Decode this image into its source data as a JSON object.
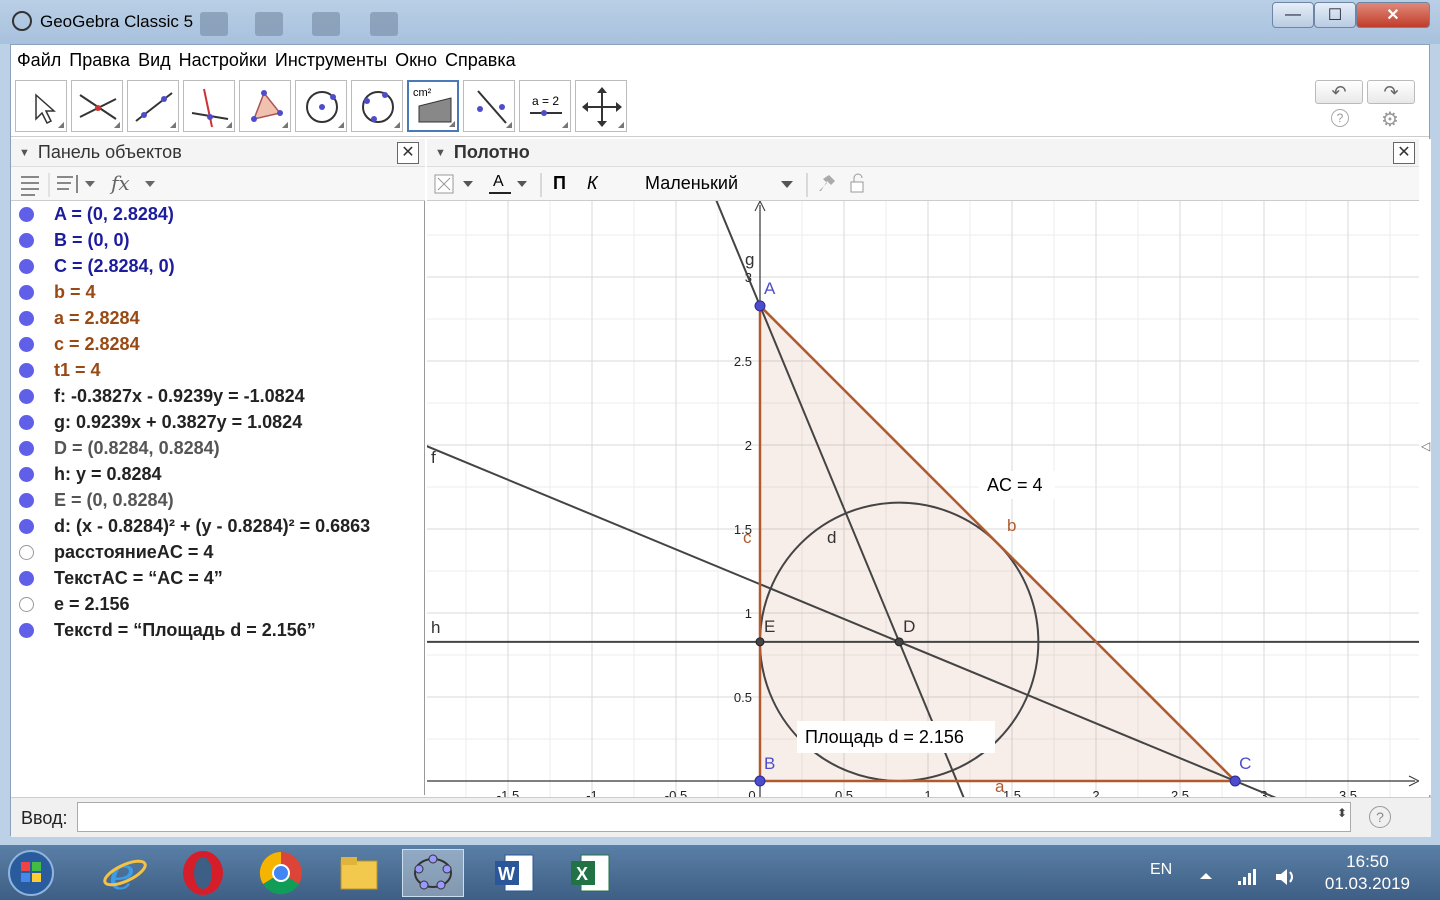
{
  "window": {
    "title": "GeoGebra Classic 5",
    "min_symbol": "—",
    "max_symbol": "☐",
    "close_symbol": "✕"
  },
  "menu": [
    "Файл",
    "Правка",
    "Вид",
    "Настройки",
    "Инструменты",
    "Окно",
    "Справка"
  ],
  "toolbar": {
    "tools": [
      "move-tool",
      "point-on-intersection-tool",
      "line-tool",
      "perpendicular-line-tool",
      "polygon-tool",
      "circle-center-tool",
      "circle-three-points-tool",
      "area-tool",
      "reflect-tool",
      "slider-tool",
      "move-view-tool"
    ],
    "area_label": "cm²",
    "slider_label": "a = 2",
    "undo_symbol": "↶",
    "redo_symbol": "↷",
    "help_symbol": "?",
    "settings_symbol": "⚙"
  },
  "algebra": {
    "title": "Панель объектов",
    "fx_label": "fx",
    "items": [
      {
        "text": "A = (0, 2.8284)",
        "color": "#1c1c9c",
        "shown": true
      },
      {
        "text": "B = (0, 0)",
        "color": "#1c1c9c",
        "shown": true
      },
      {
        "text": "C = (2.8284, 0)",
        "color": "#1c1c9c",
        "shown": true
      },
      {
        "text": "b = 4",
        "color": "#994a14",
        "shown": true
      },
      {
        "text": "a = 2.8284",
        "color": "#994a14",
        "shown": true
      },
      {
        "text": "c = 2.8284",
        "color": "#994a14",
        "shown": true
      },
      {
        "text": "t1 = 4",
        "color": "#994a14",
        "shown": true
      },
      {
        "text": "f: -0.3827x - 0.9239y = -1.0824",
        "color": "#222222",
        "shown": true
      },
      {
        "text": "g: 0.9239x + 0.3827y = 1.0824",
        "color": "#222222",
        "shown": true
      },
      {
        "text": "D = (0.8284, 0.8284)",
        "color": "#555555",
        "shown": true
      },
      {
        "text": "h: y = 0.8284",
        "color": "#222222",
        "shown": true
      },
      {
        "text": "E = (0, 0.8284)",
        "color": "#555555",
        "shown": true
      },
      {
        "text": "d: (x - 0.8284)² + (y - 0.8284)² = 0.6863",
        "color": "#222222",
        "shown": true
      },
      {
        "text": "расстояниеAC = 4",
        "color": "#222222",
        "shown": false
      },
      {
        "text": "ТекстAC = “AC = 4”",
        "color": "#222222",
        "shown": true
      },
      {
        "text": "e = 2.156",
        "color": "#222222",
        "shown": false
      },
      {
        "text": "Текстd = “Площадь d = 2.156”",
        "color": "#222222",
        "shown": true
      }
    ]
  },
  "graphics": {
    "title": "Полотно",
    "style_bar": {
      "text_color_label": "A",
      "bold_label": "П",
      "italic_label": "К",
      "size_label": "Маленький"
    },
    "x_ticks": [
      "-1.5",
      "-1",
      "-0.5",
      "0",
      "0.5",
      "1",
      "1.5",
      "2",
      "2.5",
      "3",
      "3.5"
    ],
    "y_ticks": [
      "0.5",
      "1",
      "1.5",
      "2",
      "2.5",
      "3"
    ],
    "points": [
      {
        "name": "A",
        "label": "A"
      },
      {
        "name": "B",
        "label": "B"
      },
      {
        "name": "C",
        "label": "C"
      },
      {
        "name": "D",
        "label": "D"
      },
      {
        "name": "E",
        "label": "E"
      }
    ],
    "line_labels": {
      "f": "f",
      "g": "g",
      "h": "h",
      "a": "a",
      "b": "b",
      "c": "c",
      "d": "d"
    },
    "texts": {
      "ac": "AC = 4",
      "area": "Площадь d = 2.156"
    },
    "triangle_color": "#b05a2e",
    "point_color": "#4d4dcc"
  },
  "input": {
    "label": "Ввод:",
    "value": "",
    "help_symbol": "?"
  },
  "taskbar": {
    "lang": "EN",
    "time": "16:50",
    "date": "01.03.2019"
  }
}
